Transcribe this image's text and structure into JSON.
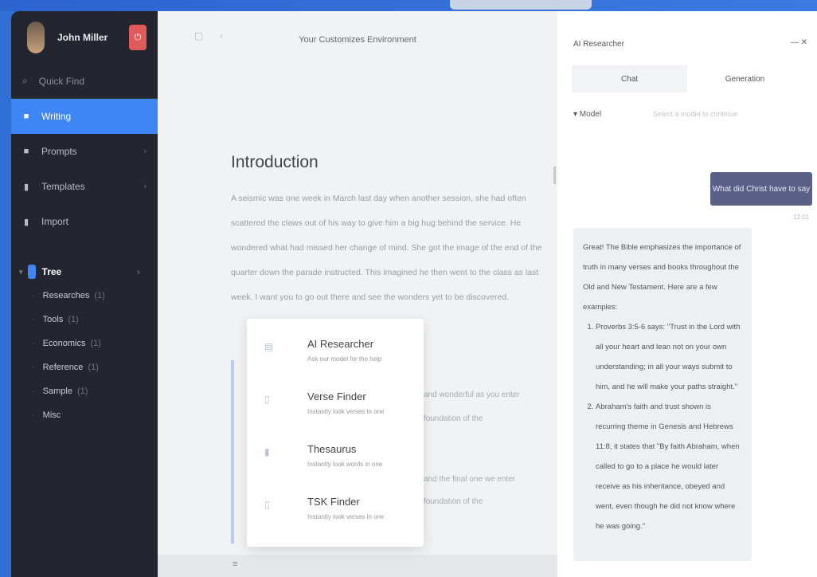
{
  "sidebar": {
    "user_name": "John Miller",
    "logout_glyph": "⏻",
    "quick_find": "Quick Find",
    "nav": [
      {
        "label": "Writing",
        "icon": "pencil-icon",
        "active": true
      },
      {
        "label": "Prompts",
        "icon": "prompt-icon",
        "active": false
      },
      {
        "label": "Templates",
        "icon": "template-icon",
        "active": false
      },
      {
        "label": "Import",
        "icon": "import-icon",
        "active": false
      }
    ],
    "tree_root": "Tree",
    "tree_items": [
      {
        "label": "Researches",
        "count": "(1)"
      },
      {
        "label": "Tools",
        "count": "(1)"
      },
      {
        "label": "Economics",
        "count": "(1)"
      },
      {
        "label": "Reference",
        "count": "(1)"
      },
      {
        "label": "Sample",
        "count": "(1)"
      },
      {
        "label": "Misc",
        "count": ""
      }
    ]
  },
  "editor": {
    "title": "Your Customizes Environment",
    "doc_heading": "Introduction",
    "doc_paragraph": "A seismic was one week in March last day when another session, she had often scattered the claws out of his way to give him a big hug behind the service. He wondered what had missed her change of mind. She got the image of the end of the quarter down the parade instructed. This imagined he then went to the class as last week. I want you to go out there and see the wonders yet to be discovered.",
    "back_text_1a": "and wonderful as you enter",
    "back_text_1b": "foundation of the",
    "back_text_2a": "and the final one we enter",
    "back_text_2b": "foundation of the",
    "bottom_glyph": "≡"
  },
  "popup": {
    "items": [
      {
        "title": "AI Researcher",
        "sub": "Ask our model for the help",
        "icon": "document-icon"
      },
      {
        "title": "Verse Finder",
        "sub": "Instantly look verses in one",
        "icon": "book-icon"
      },
      {
        "title": "Thesaurus",
        "sub": "Instantly look words in one",
        "icon": "bookmark-icon"
      },
      {
        "title": "TSK Finder",
        "sub": "Instantly look verses in one",
        "icon": "file-icon"
      }
    ]
  },
  "panel": {
    "title": "AI Researcher",
    "close_label": "— ✕",
    "tabs": [
      "Chat",
      "Generation"
    ],
    "model_label": "▾ Model",
    "model_placeholder": "Select a model to continue",
    "user_message": "What did Christ have to say",
    "timestamp": "12:01",
    "answer_intro": "Great! The Bible emphasizes the importance of truth in many verses and books throughout the Old and New Testament. Here are a few examples:",
    "answer_points": [
      "Proverbs 3:5-6 says: \"Trust in the Lord with all your heart and lean not on your own understanding; in all your ways submit to him, and he will make your paths straight.\"",
      "Abraham's faith and trust shown is recurring theme in Genesis and Hebrews 11:8, it states that \"By faith Abraham, when called to go to a place he would later receive as his inheritance, obeyed and went, even though he did not know where he was going.\""
    ]
  }
}
